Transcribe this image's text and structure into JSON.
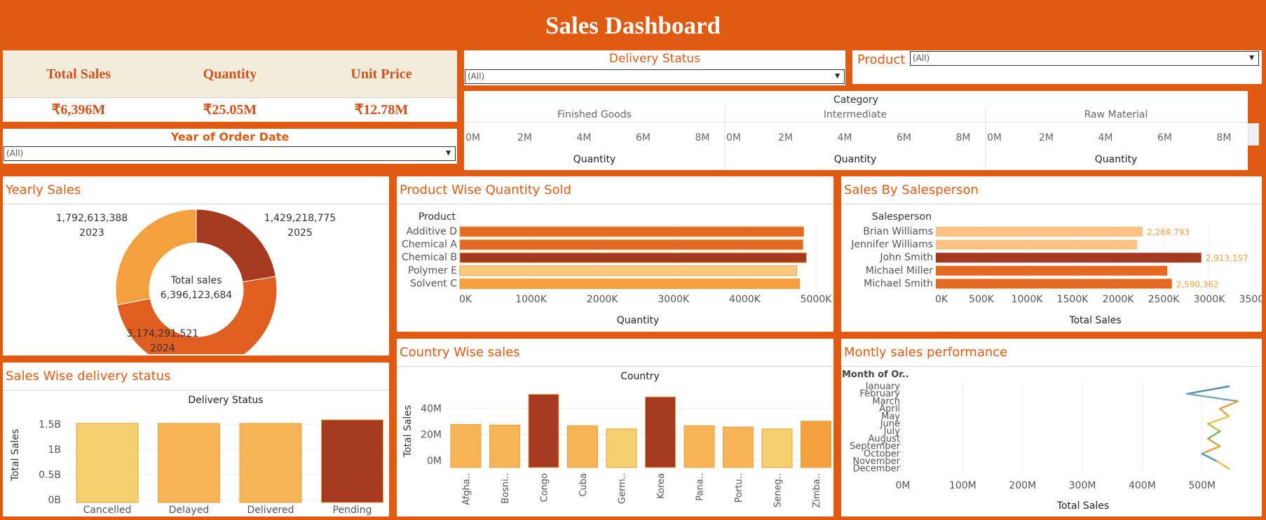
{
  "header": {
    "title": "Sales Dashboard"
  },
  "kpis": [
    {
      "label": "Total Sales",
      "value": "₹6,396M"
    },
    {
      "label": "Quantity",
      "value": "₹25.05M"
    },
    {
      "label": "Unit Price",
      "value": "₹12.78M"
    }
  ],
  "filters": {
    "year": {
      "label": "Year of Order Date",
      "value": "(All)"
    },
    "delivery": {
      "label": "Delivery Status",
      "value": "(All)"
    },
    "product": {
      "label": "Product",
      "value": "(All)"
    }
  },
  "category_panel": {
    "header": "Category",
    "groups": [
      "Finished Goods",
      "Intermediate",
      "Raw Material"
    ],
    "ticks": [
      "0M",
      "2M",
      "4M",
      "6M",
      "8M"
    ],
    "axis_label": "Quantity"
  },
  "yearly_sales": {
    "title": "Yearly Sales",
    "center_label": "Total sales",
    "center_value": "6,396,123,684",
    "slices": [
      {
        "year": "2025",
        "value": 1429218775,
        "label": "1,429,218,775",
        "color": "#A63A20"
      },
      {
        "year": "2024",
        "value": 3174291521,
        "label": "3,174,291,521",
        "color": "#E05E1F"
      },
      {
        "year": "2023",
        "value": 1792613388,
        "label": "1,792,613,388",
        "color": "#F4A03F"
      }
    ]
  },
  "product_qty": {
    "title": "Product Wise Quantity Sold",
    "axis_header": "Product",
    "categories": [
      "Additive D",
      "Chemical A",
      "Chemical B",
      "Polymer E",
      "Solvent C"
    ],
    "values": [
      5020,
      5010,
      5060,
      4920,
      4960
    ],
    "colors": [
      "#E46A24",
      "#E46A24",
      "#A63A20",
      "#FCC67F",
      "#F4A03F"
    ],
    "ticks": [
      "0K",
      "1000K",
      "2000K",
      "3000K",
      "4000K",
      "5000K"
    ],
    "xmax": 5200,
    "xlabel": "Quantity"
  },
  "salesperson": {
    "title": "Sales By Salesperson",
    "axis_header": "Salesperson",
    "categories": [
      "Brian Williams",
      "Jennifer Williams",
      "John Smith",
      "Michael Miller",
      "Michael Smith"
    ],
    "values": [
      2269793,
      2210000,
      2913157,
      2540000,
      2590362
    ],
    "labels": [
      "2,269,793",
      "",
      "2,913,157",
      "",
      "2,590,362"
    ],
    "colors": [
      "#FDC283",
      "#FDC283",
      "#A63A20",
      "#E46A24",
      "#E46A24"
    ],
    "ticks": [
      "0K",
      "500K",
      "1000K",
      "1500K",
      "2000K",
      "2500K",
      "3000K",
      "3500K"
    ],
    "xmax": 3500000,
    "xlabel": "Total Sales"
  },
  "delivery_status": {
    "title": "Sales Wise delivery status",
    "axis_header": "Delivery Status",
    "categories": [
      "Cancelled",
      "Delayed",
      "Delivered",
      "Pending"
    ],
    "values": [
      1.57,
      1.57,
      1.57,
      1.64
    ],
    "colors": [
      "#F4D06F",
      "#F6B456",
      "#F6B456",
      "#A63A20"
    ],
    "ticks": [
      "0B",
      "0.5B",
      "1B",
      "1.5B"
    ],
    "ymax": 1.75,
    "ylabel": "Total Sales"
  },
  "country_sales": {
    "title": "Country Wise sales",
    "axis_header": "Country",
    "categories": [
      "Afgha..",
      "Bosni..",
      "Congo",
      "Cuba",
      "Germ..",
      "Korea",
      "Pana..",
      "Portu..",
      "Seneg..",
      "Zimba.."
    ],
    "values": [
      33,
      32.5,
      56,
      32,
      29.5,
      54,
      32,
      31,
      29.5,
      35.5
    ],
    "colors": [
      "#F6B456",
      "#F6B456",
      "#A63A20",
      "#F6B456",
      "#F4D06F",
      "#A63A20",
      "#F6B456",
      "#F6B456",
      "#F4D06F",
      "#F4A03F"
    ],
    "ticks": [
      "0M",
      "20M",
      "40M"
    ],
    "ymax": 60,
    "ylabel": "Total Sales"
  },
  "monthly_sales": {
    "title": "Montly sales performance",
    "axis_header": "Month of Or..",
    "months": [
      "January",
      "February",
      "March",
      "April",
      "May",
      "June",
      "July",
      "August",
      "September",
      "October",
      "November",
      "December"
    ],
    "values": [
      545,
      475,
      560,
      530,
      545,
      510,
      530,
      510,
      530,
      500,
      525,
      545
    ],
    "ticks": [
      "0M",
      "100M",
      "200M",
      "300M",
      "400M",
      "500M"
    ],
    "xmax": 580,
    "xlabel": "Total Sales"
  }
}
